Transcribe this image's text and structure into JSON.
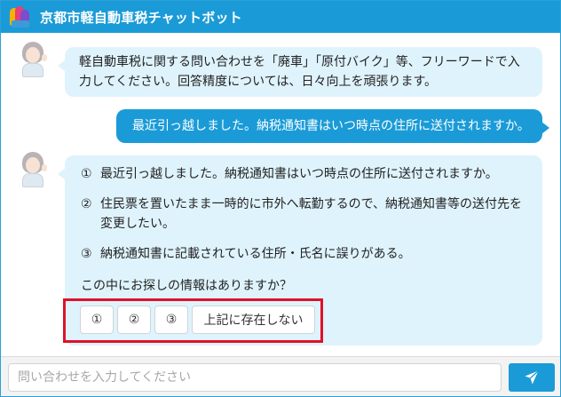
{
  "header": {
    "title": "京都市軽自動車税チャットボット",
    "logo_icon": "kyoto-logo-icon"
  },
  "messages": {
    "bot1": {
      "line1": "軽自動車税に関する問い合わせを「廃車」「原付バイク」等、フリーワードで入",
      "line2": "力してください。回答精度については、日々向上を頑張ります。"
    },
    "user1": {
      "text": "最近引っ越しました。納税通知書はいつ時点の住所に送付されますか。"
    },
    "bot2": {
      "options": [
        {
          "num": "①",
          "lines": [
            "最近引っ越しました。納税通知書はいつ時点の住所に送付されますか。"
          ]
        },
        {
          "num": "②",
          "lines": [
            "住民票を置いたまま一時的に市外へ転勤するので、納税通知書等の送付先を",
            "変更したい。"
          ]
        },
        {
          "num": "③",
          "lines": [
            "納税通知書に記載されている住所・氏名に誤りがある。"
          ]
        }
      ],
      "question": "この中にお探しの情報はありますか？",
      "choices": [
        "①",
        "②",
        "③",
        "上記に存在しない"
      ]
    }
  },
  "footer": {
    "input_placeholder": "問い合わせを入力してください",
    "input_value": "",
    "send_icon": "send-icon"
  },
  "colors": {
    "brand": "#1a9bd7",
    "bot_bubble": "#dff3fc",
    "highlight": "#e0102a"
  }
}
